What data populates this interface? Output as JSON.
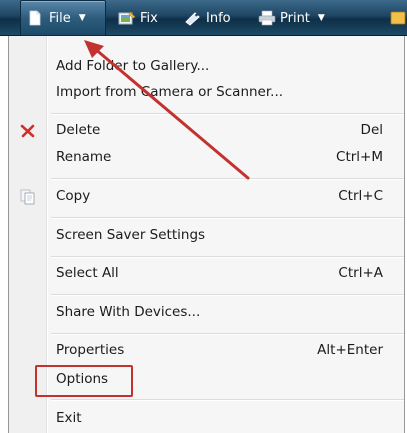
{
  "toolbar": {
    "items": [
      {
        "label": "File",
        "icon": "document-icon",
        "has_caret": true
      },
      {
        "label": "Fix",
        "icon": "fix-icon",
        "has_caret": false
      },
      {
        "label": "Info",
        "icon": "info-icon",
        "has_caret": false
      },
      {
        "label": "Print",
        "icon": "printer-icon",
        "has_caret": true
      }
    ]
  },
  "menu": {
    "items": [
      {
        "label": "Add Folder to Gallery...",
        "shortcut": ""
      },
      {
        "label": "Import from Camera or Scanner...",
        "shortcut": ""
      },
      {
        "label": "Delete",
        "shortcut": "Del",
        "icon": "delete-icon"
      },
      {
        "label": "Rename",
        "shortcut": "Ctrl+M"
      },
      {
        "label": "Copy",
        "shortcut": "Ctrl+C",
        "icon": "copy-icon"
      },
      {
        "label": "Screen Saver Settings",
        "shortcut": ""
      },
      {
        "label": "Select All",
        "shortcut": "Ctrl+A"
      },
      {
        "label": "Share With Devices...",
        "shortcut": ""
      },
      {
        "label": "Properties",
        "shortcut": "Alt+Enter"
      },
      {
        "label": "Options",
        "shortcut": ""
      },
      {
        "label": "Exit",
        "shortcut": ""
      }
    ]
  },
  "colors": {
    "annotation_red": "#c2322e",
    "toolbar_dark": "#1d4563"
  }
}
